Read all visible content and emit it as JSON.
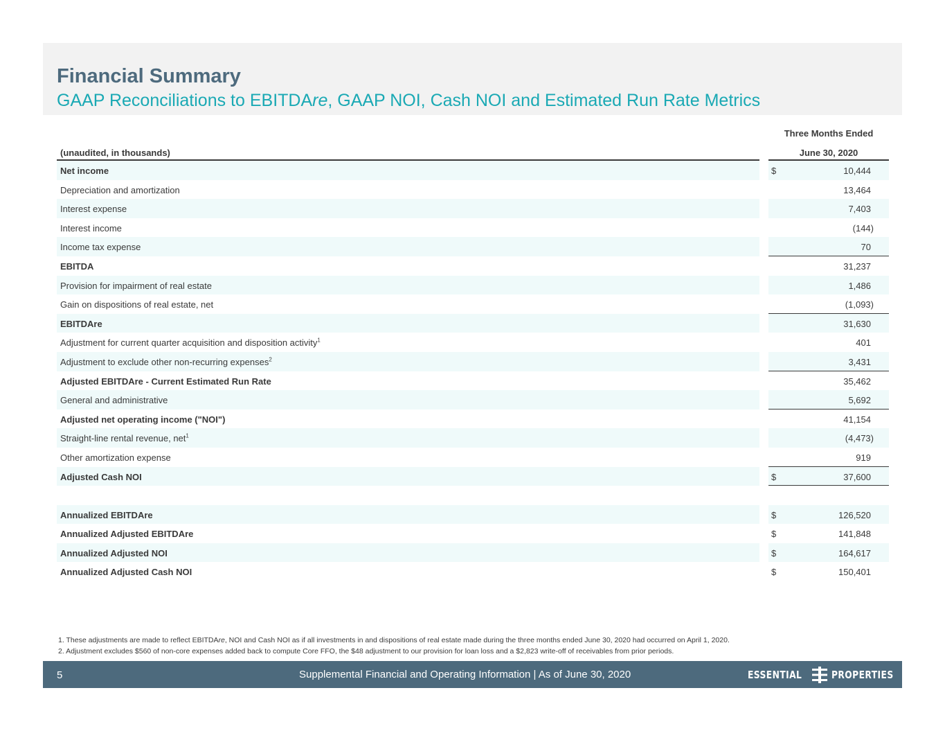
{
  "header": {
    "title": "Financial Summary",
    "subtitle_part1": "GAAP Reconciliations to EBITDA",
    "subtitle_italic": "re",
    "subtitle_part2": ", GAAP NOI, Cash NOI and Estimated Run Rate Metrics"
  },
  "table": {
    "period_header_line1": "Three Months Ended",
    "period_header_line2": "June 30, 2020",
    "units_label": "(unaudited, in thousands)",
    "rows": [
      {
        "label": "Net income",
        "sup": "",
        "dollar": "$",
        "value": "10,444"
      },
      {
        "label": "Depreciation and amortization",
        "sup": "",
        "dollar": "",
        "value": "13,464"
      },
      {
        "label": "Interest expense",
        "sup": "",
        "dollar": "",
        "value": "7,403"
      },
      {
        "label": "Interest income",
        "sup": "",
        "dollar": "",
        "value": "(144)"
      },
      {
        "label": "Income tax expense",
        "sup": "",
        "dollar": "",
        "value": "70"
      },
      {
        "label": "EBITDA",
        "sup": "",
        "dollar": "",
        "value": "31,237"
      },
      {
        "label": "Provision for impairment of real estate",
        "sup": "",
        "dollar": "",
        "value": "1,486"
      },
      {
        "label": "Gain on dispositions of real estate, net",
        "sup": "",
        "dollar": "",
        "value": "(1,093)"
      },
      {
        "label": "EBITDAre",
        "sup": "",
        "dollar": "",
        "value": "31,630"
      },
      {
        "label": "Adjustment for current quarter acquisition and disposition activity",
        "sup": "1",
        "dollar": "",
        "value": "401"
      },
      {
        "label": "Adjustment to exclude other non-recurring expenses",
        "sup": "2",
        "dollar": "",
        "value": "3,431"
      },
      {
        "label": "Adjusted EBITDAre - Current Estimated Run Rate",
        "sup": "",
        "dollar": "",
        "value": "35,462"
      },
      {
        "label": "General and administrative",
        "sup": "",
        "dollar": "",
        "value": "5,692"
      },
      {
        "label": "Adjusted net operating income (\"NOI\")",
        "sup": "",
        "dollar": "",
        "value": "41,154"
      },
      {
        "label": "Straight-line rental revenue, net",
        "sup": "1",
        "dollar": "",
        "value": "(4,473)"
      },
      {
        "label": "Other amortization expense",
        "sup": "",
        "dollar": "",
        "value": "919"
      },
      {
        "label": "Adjusted Cash NOI",
        "sup": "",
        "dollar": "$",
        "value": "37,600"
      },
      {
        "label": "",
        "sup": "",
        "dollar": "",
        "value": ""
      },
      {
        "label": "Annualized EBITDAre",
        "sup": "",
        "dollar": "$",
        "value": "126,520"
      },
      {
        "label": "Annualized Adjusted EBITDAre",
        "sup": "",
        "dollar": "$",
        "value": "141,848"
      },
      {
        "label": "Annualized Adjusted NOI",
        "sup": "",
        "dollar": "$",
        "value": "164,617"
      },
      {
        "label": "Annualized Adjusted Cash NOI",
        "sup": "",
        "dollar": "$",
        "value": "150,401"
      }
    ]
  },
  "footnotes": {
    "note1_a": "1. These adjustments are made to reflect EBITDA",
    "note1_italic": "re",
    "note1_b": ", NOI and Cash NOI as if all investments in and dispositions of real estate made during the three months ended June 30, 2020 had occurred on April 1, 2020.",
    "note2": "2. Adjustment excludes $560 of non-core expenses added back to compute Core FFO, the $48 adjustment to our provision for loan loss and a $2,823 write-off of receivables from prior periods."
  },
  "footer": {
    "page_number": "5",
    "text": "Supplemental Financial and Operating Information |  As of June 30, 2020",
    "logo_left": "ESSENTIAL",
    "logo_right": "PROPERTIES"
  }
}
